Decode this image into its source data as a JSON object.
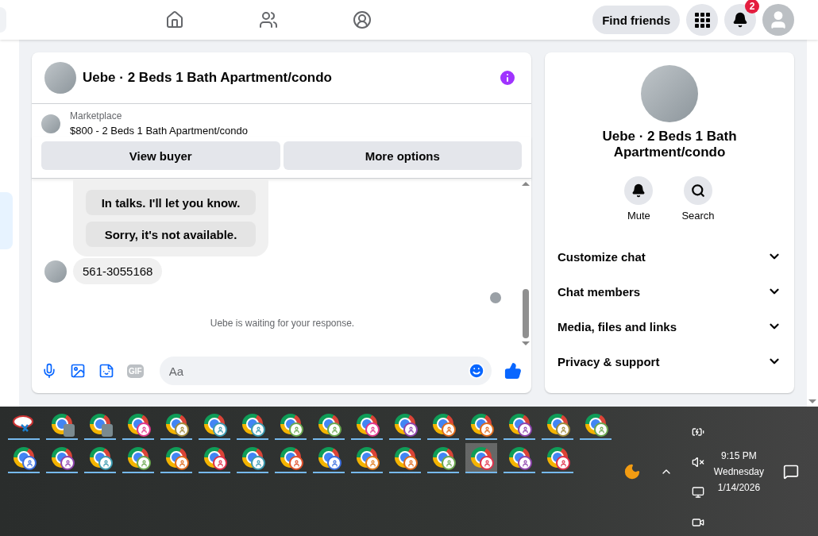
{
  "topbar": {
    "find_friends": "Find friends",
    "notification_count": "2"
  },
  "chat": {
    "title": "Uebe · 2 Beds 1 Bath Apartment/condo",
    "listing_source": "Marketplace",
    "listing": "$800 - 2 Beds 1 Bath Apartment/condo",
    "actions": [
      "View buyer",
      "More options"
    ],
    "quick_replies": [
      "In talks. I'll let you know.",
      "Sorry, it's not available."
    ],
    "messages": [
      {
        "text": "561-3055168"
      }
    ],
    "status": "Uebe is waiting for your response.",
    "composer": {
      "placeholder": "Aa",
      "gif": "GIF"
    }
  },
  "details": {
    "title": "Uebe · 2 Beds 1 Bath Apartment/condo",
    "quick_actions": [
      {
        "kind": "mute",
        "label": "Mute"
      },
      {
        "kind": "search",
        "label": "Search"
      }
    ],
    "sections": [
      {
        "label": "Customize chat",
        "expanded": false
      },
      {
        "label": "Chat members",
        "expanded": false
      },
      {
        "label": "Media, files and links",
        "expanded": false
      },
      {
        "label": "Privacy & support",
        "expanded": false
      }
    ]
  },
  "taskbar": {
    "rows": [
      [
        {
          "kind": "snip",
          "selected": false
        },
        {
          "kind": "photo",
          "selected": false
        },
        {
          "kind": "photo",
          "selected": false
        },
        {
          "kind": "profile",
          "color": "#e0388c",
          "selected": false
        },
        {
          "kind": "profile",
          "color": "#a08a3a",
          "selected": false
        },
        {
          "kind": "profile",
          "color": "#3a9ab0",
          "selected": false
        },
        {
          "kind": "profile",
          "color": "#3a9ab0",
          "selected": false
        },
        {
          "kind": "profile",
          "color": "#6aa84f",
          "selected": false
        },
        {
          "kind": "profile",
          "color": "#6aa84f",
          "selected": false
        },
        {
          "kind": "profile",
          "color": "#e0388c",
          "selected": false
        },
        {
          "kind": "profile",
          "color": "#8e44ad",
          "selected": false
        },
        {
          "kind": "profile",
          "color": "#e06a1a",
          "selected": false
        },
        {
          "kind": "profile",
          "color": "#e06a1a",
          "selected": false
        },
        {
          "kind": "profile",
          "color": "#8e44ad",
          "selected": false
        },
        {
          "kind": "profile",
          "color": "#a08a3a",
          "selected": false
        },
        {
          "kind": "profile",
          "color": "#6aa84f",
          "selected": false
        }
      ],
      [
        {
          "kind": "profile",
          "color": "#3a6ee0",
          "selected": false
        },
        {
          "kind": "profile",
          "color": "#8e44ad",
          "selected": false
        },
        {
          "kind": "profile",
          "color": "#3a9ab0",
          "selected": false
        },
        {
          "kind": "profile",
          "color": "#6aa84f",
          "selected": false
        },
        {
          "kind": "profile",
          "color": "#e06a1a",
          "selected": false
        },
        {
          "kind": "profile",
          "color": "#e0304a",
          "selected": false
        },
        {
          "kind": "profile",
          "color": "#3a9ab0",
          "selected": false
        },
        {
          "kind": "profile",
          "color": "#e0502a",
          "selected": false
        },
        {
          "kind": "profile",
          "color": "#3a6ee0",
          "selected": false
        },
        {
          "kind": "profile",
          "color": "#e07a1a",
          "selected": false
        },
        {
          "kind": "profile",
          "color": "#e06a1a",
          "selected": false
        },
        {
          "kind": "profile",
          "color": "#6aa84f",
          "selected": false
        },
        {
          "kind": "profile",
          "color": "#e0304a",
          "selected": true
        },
        {
          "kind": "profile",
          "color": "#8e44ad",
          "selected": false
        },
        {
          "kind": "profile",
          "color": "#e0304a",
          "selected": false
        }
      ]
    ],
    "time": "9:15 PM",
    "day": "Wednesday",
    "date": "1/14/2026"
  }
}
